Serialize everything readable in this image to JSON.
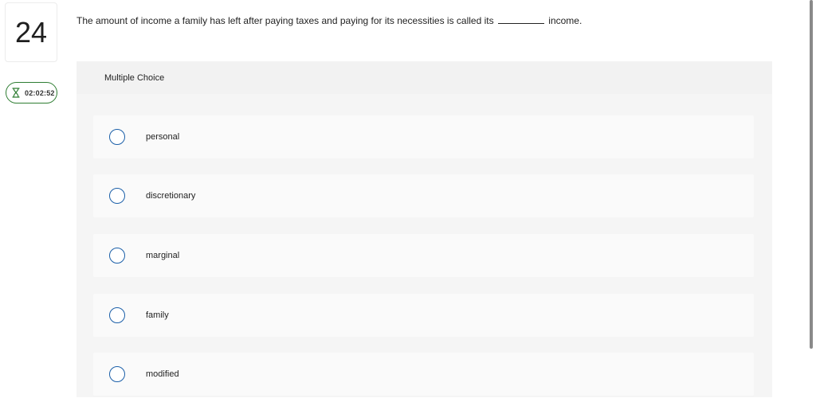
{
  "question": {
    "number": "24",
    "text_before": "The amount of income a family has left after paying taxes and paying for its necessities is called its",
    "text_after": "income."
  },
  "timer": {
    "value": "02:02:52",
    "icon": "hourglass-icon",
    "color": "#2e7d32"
  },
  "panel": {
    "header": "Multiple Choice",
    "choices": [
      {
        "label": "personal"
      },
      {
        "label": "discretionary"
      },
      {
        "label": "marginal"
      },
      {
        "label": "family"
      },
      {
        "label": "modified"
      }
    ]
  },
  "colors": {
    "radio_border": "#1b5fa8",
    "panel_bg": "#f4f4f4",
    "choice_bg": "#fafafa"
  }
}
